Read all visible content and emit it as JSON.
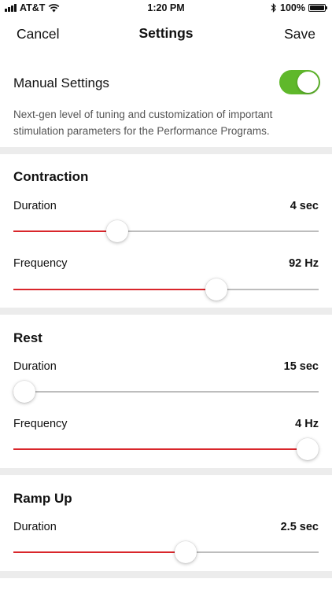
{
  "status_bar": {
    "carrier": "AT&T",
    "time": "1:20 PM",
    "battery_percent": "100%",
    "icons": [
      "signal-icon",
      "wifi-icon",
      "bluetooth-icon",
      "battery-icon"
    ]
  },
  "nav": {
    "left_label": "Cancel",
    "title": "Settings",
    "right_label": "Save"
  },
  "manual_settings": {
    "label": "Manual Settings",
    "enabled": true,
    "description": "Next-gen level of tuning and customization of important stimulation parameters for the Performance Programs."
  },
  "sections": {
    "contraction": {
      "title": "Contraction",
      "duration": {
        "label": "Duration",
        "value": "4 sec",
        "level": 0.34
      },
      "frequency": {
        "label": "Frequency",
        "value": "92 Hz",
        "level": 0.665
      }
    },
    "rest": {
      "title": "Rest",
      "duration": {
        "label": "Duration",
        "value": "15 sec",
        "level": 0.035
      },
      "frequency": {
        "label": "Frequency",
        "value": "4 Hz",
        "level": 0.965
      }
    },
    "ramp_up": {
      "title": "Ramp Up",
      "duration": {
        "label": "Duration",
        "value": "2.5 sec",
        "level": 0.565
      }
    }
  },
  "colors": {
    "accent": "#d9262b",
    "toggle_on": "#5fb82b",
    "track": "#bdbdbd",
    "divider": "#ececec"
  }
}
